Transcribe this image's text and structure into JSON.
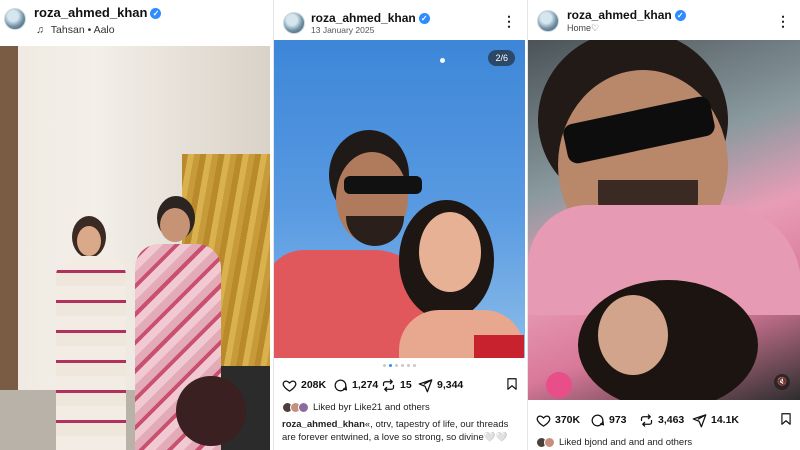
{
  "panels": [
    {
      "username": "roza_ahmed_khan",
      "subtitle": "Tahsan • Aalo",
      "has_music": true
    },
    {
      "username": "roza_ahmed_khan",
      "subtitle": "13 January 2025",
      "media_counter": "2/6",
      "carousel": {
        "total": 6,
        "active": 1
      },
      "actions": {
        "likes": "208K",
        "comments": "1,274",
        "reposts": "15",
        "shares": "9,344"
      },
      "liked_by": "Liked byr     Like21 and others",
      "caption_user": "roza_ahmed_khan",
      "caption_text": "«, otrv, tapestry of life, our threads are forever entwined, a love so strong, so divine🤍🤍"
    },
    {
      "username": "roza_ahmed_khan",
      "subtitle": "Home♡",
      "actions": {
        "likes": "370K",
        "comments": "973",
        "reposts": "3,463",
        "shares": "14.1K"
      },
      "liked_by": "Liked bjond and and and others"
    }
  ],
  "colors": {
    "verified": "#2f8cff",
    "carousel_active": "#2f8cff"
  },
  "icons": [
    "music-note-icon",
    "verified-badge-icon",
    "more-options-icon",
    "heart-icon",
    "comment-icon",
    "repost-icon",
    "share-icon",
    "bookmark-icon",
    "mute-icon"
  ]
}
